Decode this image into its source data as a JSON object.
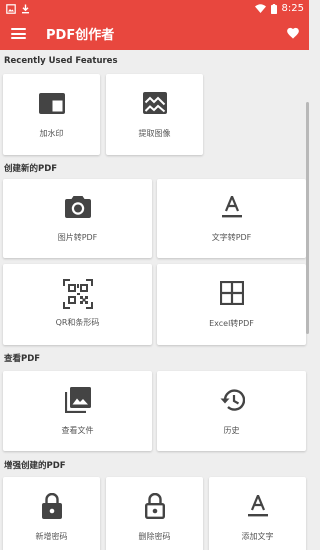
{
  "status_bar": {
    "time": "8:25",
    "icons": [
      "image-notification-icon",
      "download-icon",
      "wifi-icon",
      "battery-icon"
    ]
  },
  "app_bar": {
    "title": "PDF创作者",
    "icons": [
      "menu-icon",
      "heart-icon"
    ]
  },
  "sections": [
    {
      "title": "Recently Used Features",
      "items": [
        {
          "label": "加水印",
          "icon": "watermark-icon"
        },
        {
          "label": "提取图像",
          "icon": "image-extract-icon"
        }
      ]
    },
    {
      "title": "创建新的PDF",
      "items": [
        {
          "label": "图片转PDF",
          "icon": "camera-icon"
        },
        {
          "label": "文字转PDF",
          "icon": "text-format-icon"
        },
        {
          "label": "QR和条形码",
          "icon": "qr-code-icon"
        },
        {
          "label": "Excel转PDF",
          "icon": "grid-icon"
        }
      ]
    },
    {
      "title": "查看PDF",
      "items": [
        {
          "label": "查看文件",
          "icon": "photo-library-icon"
        },
        {
          "label": "历史",
          "icon": "history-icon"
        }
      ]
    },
    {
      "title": "增强创建的PDF",
      "items": [
        {
          "label": "新增密码",
          "icon": "lock-icon"
        },
        {
          "label": "删除密码",
          "icon": "lock-open-icon"
        },
        {
          "label": "添加文字",
          "icon": "text-format-icon"
        }
      ]
    }
  ],
  "colors": {
    "primary": "#e8473e",
    "background": "#eeeeee",
    "card": "#ffffff",
    "icon": "#444444"
  }
}
